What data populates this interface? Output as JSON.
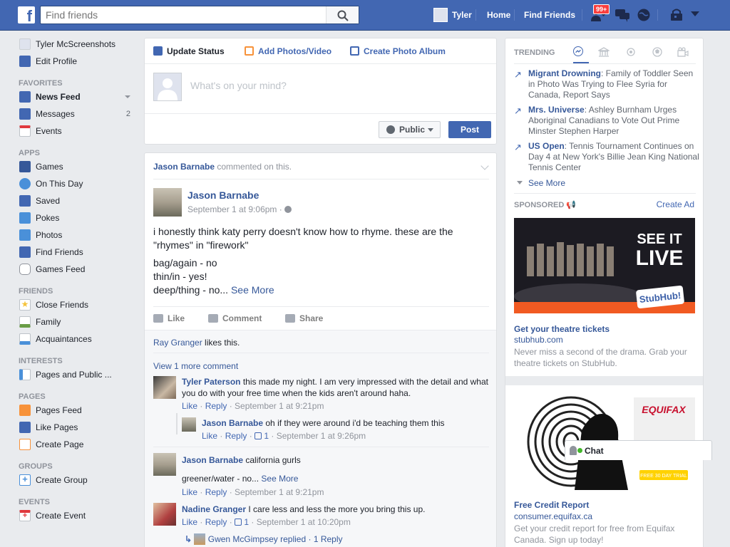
{
  "topbar": {
    "logo": "f",
    "search_placeholder": "Find friends",
    "user": "Tyler",
    "home": "Home",
    "find_friends": "Find Friends",
    "notif_count": "99+",
    "icons": [
      "friend-requests-icon",
      "messages-icon",
      "notifications-icon",
      "privacy-icon",
      "account-menu-icon"
    ]
  },
  "left_nav": {
    "profile_name": "Tyler McScreenshots",
    "edit_profile": "Edit Profile",
    "sections": {
      "favorites": "FAVORITES",
      "apps": "APPS",
      "friends": "FRIENDS",
      "interests": "INTERESTS",
      "pages": "PAGES",
      "groups": "GROUPS",
      "events": "EVENTS"
    },
    "favorites": [
      {
        "label": "News Feed",
        "icon": "news-feed-icon",
        "color": "#4267b2"
      },
      {
        "label": "Messages",
        "icon": "messages-icon",
        "count": "2",
        "color": "#4267b2"
      },
      {
        "label": "Events",
        "icon": "calendar-icon",
        "color": "#e9ebee"
      }
    ],
    "apps": [
      {
        "label": "Games",
        "icon": "games-icon",
        "color": "#365899"
      },
      {
        "label": "On This Day",
        "icon": "on-this-day-icon",
        "color": "#4a90d9"
      },
      {
        "label": "Saved",
        "icon": "saved-icon",
        "color": "#4267b2"
      },
      {
        "label": "Pokes",
        "icon": "pokes-icon",
        "color": "#4a90d9"
      },
      {
        "label": "Photos",
        "icon": "photos-icon",
        "color": "#4a90d9"
      },
      {
        "label": "Find Friends",
        "icon": "find-friends-icon",
        "color": "#4267b2"
      },
      {
        "label": "Games Feed",
        "icon": "games-feed-icon",
        "color": "#90949c"
      }
    ],
    "friends": [
      {
        "label": "Close Friends",
        "icon": "star-icon",
        "color": "#f5c33b"
      },
      {
        "label": "Family",
        "icon": "family-icon",
        "color": "#6a9d46"
      },
      {
        "label": "Acquaintances",
        "icon": "acquaintances-icon",
        "color": "#4a90d9"
      }
    ],
    "interests": [
      {
        "label": "Pages and Public ...",
        "icon": "pages-public-icon",
        "color": "#4a90d9"
      }
    ],
    "pages": [
      {
        "label": "Pages Feed",
        "icon": "pages-feed-icon",
        "color": "#f7923a"
      },
      {
        "label": "Like Pages",
        "icon": "like-pages-icon",
        "color": "#4267b2"
      },
      {
        "label": "Create Page",
        "icon": "create-page-icon",
        "color": "#f7923a"
      }
    ],
    "groups": [
      {
        "label": "Create Group",
        "icon": "create-group-icon",
        "color": "#4a90d9"
      }
    ],
    "events": [
      {
        "label": "Create Event",
        "icon": "create-event-icon",
        "color": "#e9ebee"
      }
    ]
  },
  "composer": {
    "tab_status": "Update Status",
    "tab_photos": "Add Photos/Video",
    "tab_album": "Create Photo Album",
    "placeholder": "What's on your mind?",
    "privacy": "Public",
    "post": "Post"
  },
  "story": {
    "header_name": "Jason Barnabe",
    "header_action": " commented on this.",
    "author": "Jason Barnabe",
    "time": "September 1 at 9:06pm · ",
    "body": [
      "i honestly think katy perry doesn't know how to rhyme. these are the \"rhymes\" in \"firework\"",
      "bag/again - no",
      "thin/in - yes!",
      "deep/thing - no... "
    ],
    "see_more": "See More",
    "like": "Like",
    "comment": "Comment",
    "share": "Share",
    "likes_name": "Ray Granger",
    "likes_text": " likes this.",
    "view_more": "View 1 more comment",
    "comments": [
      {
        "name": "Tyler Paterson",
        "text": " this made my night. I am very impressed with the detail and what you do with your free time when the kids aren't around haha.",
        "like": "Like",
        "reply": "Reply",
        "time": "September 1 at 9:21pm"
      },
      {
        "name": "Jason Barnabe",
        "text": " oh if they were around i'd be teaching them this",
        "like": "Like",
        "reply": "Reply",
        "likes": "1",
        "time": "September 1 at 9:26pm"
      },
      {
        "name": "Jason Barnabe",
        "text": " california gurls",
        "extra": "greener/water - no... ",
        "see_more": "See More",
        "like": "Like",
        "reply": "Reply",
        "time": "September 1 at 9:21pm"
      },
      {
        "name": "Nadine Granger",
        "text": " I care less and less the more you bring this up.",
        "like": "Like",
        "reply": "Reply",
        "likes": "1",
        "time": "September 1 at 10:20pm"
      }
    ],
    "reply_summary_name": "Gwen McGimpsey",
    "reply_summary_text": " replied · ",
    "reply_count": "1 Reply"
  },
  "right": {
    "trending": "TRENDING",
    "trends": [
      {
        "topic": "Migrant Drowning",
        "text": ": Family of Toddler Seen in Photo Was Trying to Flee Syria for Canada, Report Says"
      },
      {
        "topic": "Mrs. Universe",
        "text": ": Ashley Burnham Urges Aboriginal Canadians to Vote Out Prime Minster Stephen Harper"
      },
      {
        "topic": "US Open",
        "text": ": Tennis Tournament Continues on Day 4 at New York's Billie Jean King National Tennis Center"
      }
    ],
    "see_more": "See More",
    "sponsored": "SPONSORED",
    "create_ad": "Create Ad",
    "ad1": {
      "banner_line1": "SEE IT",
      "banner_line2": "LIVE",
      "brand": "StubHub!",
      "title": "Get your theatre tickets",
      "url": "stubhub.com",
      "desc": "Never miss a second of the drama. Grab your theatre tickets on StubHub."
    },
    "ad2": {
      "brand": "EQUIFAX",
      "cta": "FREE 30 DAY TRIAL",
      "title": "Free Credit Report",
      "url": "consumer.equifax.ca",
      "desc": "Get your credit report for free from Equifax Canada. Sign up today!"
    }
  },
  "chat": {
    "label": "Chat"
  }
}
